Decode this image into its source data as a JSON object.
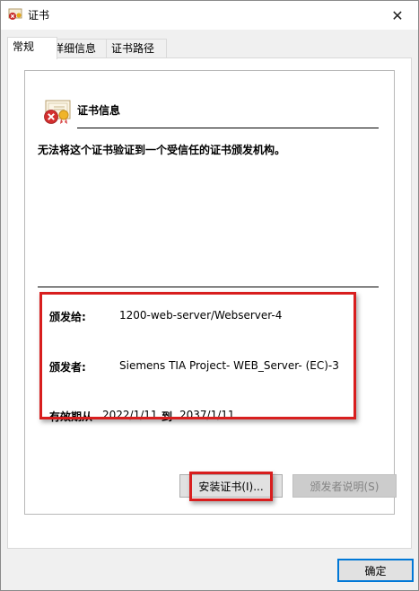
{
  "window": {
    "title": "证书",
    "close_glyph": "✕"
  },
  "tabs": [
    {
      "label": "常规",
      "active": true
    },
    {
      "label": "详细信息",
      "active": false
    },
    {
      "label": "证书路径",
      "active": false
    }
  ],
  "cert_info": {
    "heading": "证书信息",
    "warning": "无法将这个证书验证到一个受信任的证书颁发机构。",
    "issued_to_label": "颁发给:",
    "issued_to_value": "1200-web-server/Webserver-4",
    "issued_by_label": "颁发者:",
    "issued_by_value": "Siemens TIA Project- WEB_Server- (EC)-3",
    "valid_from_label": "有效期从",
    "valid_from_value": "2022/1/11",
    "valid_to_label": "到",
    "valid_to_value": "2037/1/11"
  },
  "buttons": {
    "install": "安装证书(I)...",
    "issuer_statement": "颁发者说明(S)",
    "ok": "确定"
  },
  "icons": {
    "title": "certificate-error-icon",
    "cert": "certificate-error-icon",
    "close": "close-icon"
  },
  "colors": {
    "highlight": "#d81e1e",
    "accent": "#0078d7"
  }
}
